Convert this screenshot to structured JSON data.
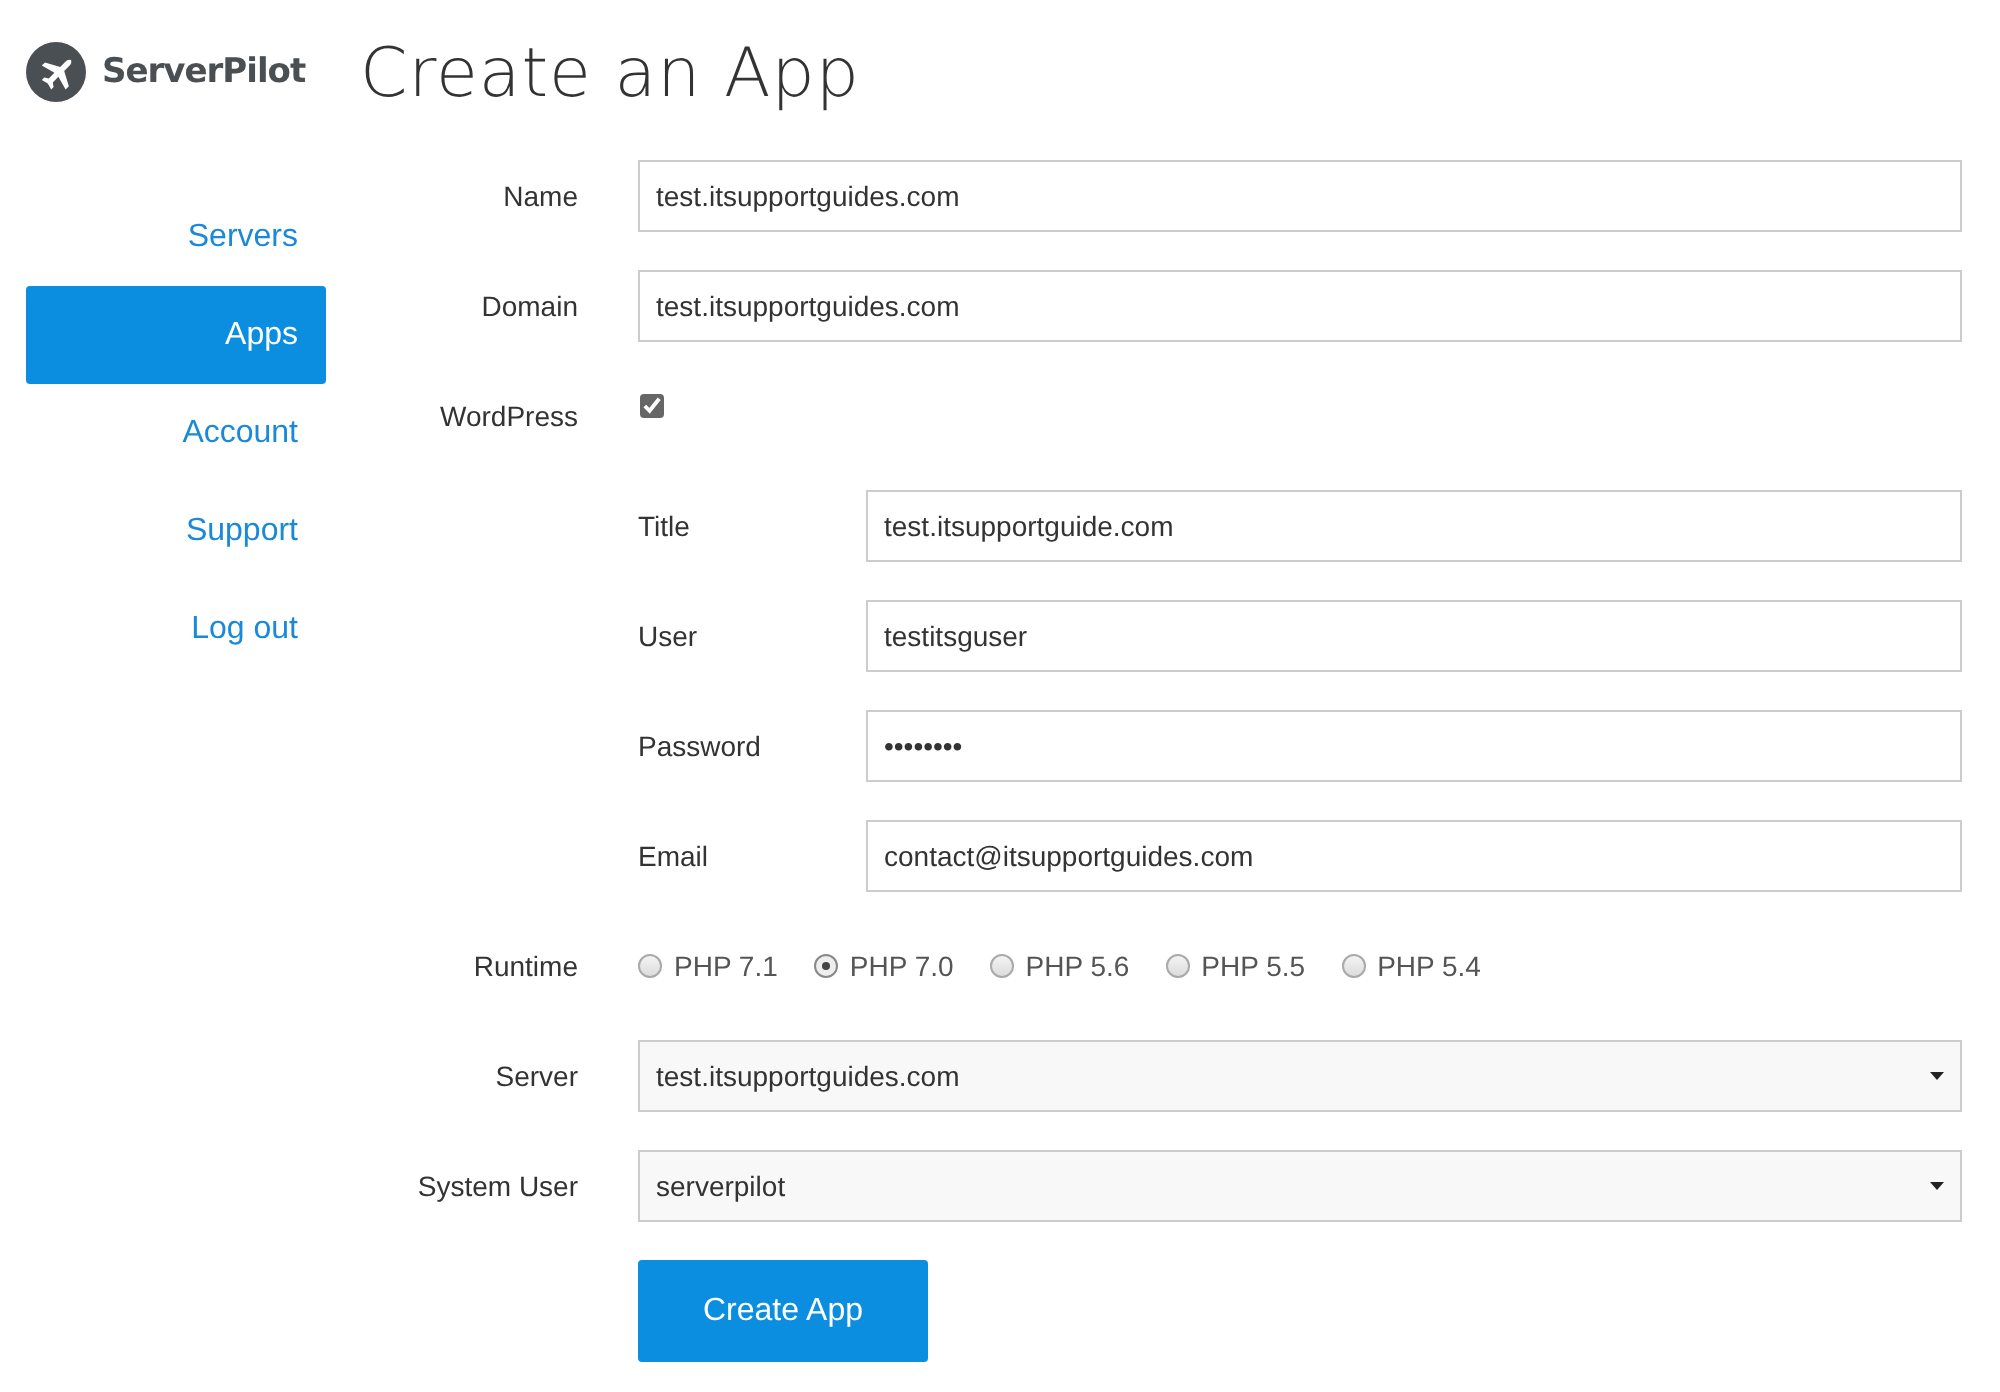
{
  "logo": {
    "text": "ServerPilot"
  },
  "nav": [
    {
      "label": "Servers",
      "selected": false
    },
    {
      "label": "Apps",
      "selected": true
    },
    {
      "label": "Account",
      "selected": false
    },
    {
      "label": "Support",
      "selected": false
    },
    {
      "label": "Log out",
      "selected": false
    }
  ],
  "heading": "Create an App",
  "form": [
    {
      "kind": "text",
      "label": "Name",
      "value": "test.itsupportguides.com"
    },
    {
      "kind": "text",
      "label": "Domain",
      "value": "test.itsupportguides.com"
    },
    {
      "kind": "checkbox",
      "label": "WordPress",
      "checked": true,
      "children": [
        {
          "kind": "text",
          "label": "Title",
          "value": "test.itsupportguide.com"
        },
        {
          "kind": "text",
          "label": "User",
          "value": "testitsguser"
        },
        {
          "kind": "text",
          "label": "Password",
          "value": "••••••••"
        },
        {
          "kind": "text",
          "label": "Email",
          "value": "contact@itsupportguides.com"
        }
      ]
    },
    {
      "kind": "radio",
      "label": "Runtime",
      "options": [
        {
          "label": "PHP 7.1",
          "selected": false
        },
        {
          "label": "PHP 7.0",
          "selected": true
        },
        {
          "label": "PHP 5.6",
          "selected": false
        },
        {
          "label": "PHP 5.5",
          "selected": false
        },
        {
          "label": "PHP 5.4",
          "selected": false
        }
      ]
    },
    {
      "kind": "select",
      "label": "Server",
      "value": "test.itsupportguides.com"
    },
    {
      "kind": "select",
      "label": "System User",
      "value": "serverpilot"
    }
  ],
  "submit": "Create App"
}
